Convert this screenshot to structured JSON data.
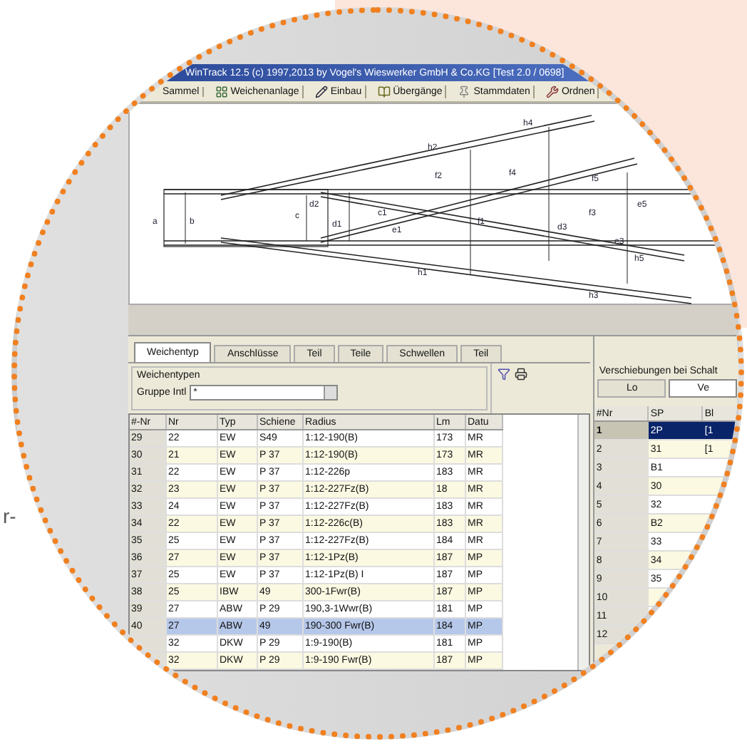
{
  "page_text": "r-",
  "window": {
    "title": "WinTrack 12.5 (c) 1997,2013 by Vogel's Wieswerker GmbH & Co.KG [Test 2.0 / 0698]"
  },
  "toolbar": [
    {
      "label": "Sammel",
      "kind": "none"
    },
    {
      "label": "Weichenanlage",
      "kind": "grid"
    },
    {
      "label": "Einbau",
      "kind": "pencil"
    },
    {
      "label": "Übergänge",
      "kind": "book"
    },
    {
      "label": "Stammdaten",
      "kind": "pin"
    },
    {
      "label": "Ordnen",
      "kind": "tools"
    }
  ],
  "drawing_labels": [
    "a",
    "b",
    "c",
    "d2",
    "d1",
    "c1",
    "e1",
    "h1",
    "h2",
    "f2",
    "f1",
    "h4",
    "f4",
    "f5",
    "f3",
    "h3",
    "d3",
    "e5",
    "e3",
    "h5"
  ],
  "tabs": [
    {
      "label": "Weichentyp",
      "selected": true
    },
    {
      "label": "Anschlüsse",
      "selected": false
    },
    {
      "label": "Teil",
      "selected": false
    },
    {
      "label": "Teile",
      "selected": false
    },
    {
      "label": "Schwellen",
      "selected": false
    },
    {
      "label": "Teil",
      "selected": false
    }
  ],
  "filter": {
    "title": "Weichentypen",
    "label": "Gruppe Intl",
    "value": "*"
  },
  "table": {
    "columns": [
      "#-Nr",
      "Nr",
      "Typ",
      "Schiene",
      "Radius",
      "Lm",
      "Datu"
    ],
    "rows": [
      {
        "cells": [
          "29",
          "22",
          "EW",
          "S49",
          "1:12-190(B)",
          "173",
          "MR"
        ],
        "selected": false
      },
      {
        "cells": [
          "30",
          "21",
          "EW",
          "P 37",
          "1:12-190(B)",
          "173",
          "MR"
        ],
        "selected": false
      },
      {
        "cells": [
          "31",
          "22",
          "EW",
          "P 37",
          "1:12-226p",
          "183",
          "MR"
        ],
        "selected": false
      },
      {
        "cells": [
          "32",
          "23",
          "EW",
          "P 37",
          "1:12-227Fz(B)",
          "18",
          "MR"
        ],
        "selected": false
      },
      {
        "cells": [
          "33",
          "24",
          "EW",
          "P 37",
          "1:12-227Fz(B)",
          "183",
          "MR"
        ],
        "selected": false
      },
      {
        "cells": [
          "34",
          "22",
          "EW",
          "P 37",
          "1:12-226c(B)",
          "183",
          "MR"
        ],
        "selected": false
      },
      {
        "cells": [
          "35",
          "25",
          "EW",
          "P 37",
          "1:12-227Fz(B)",
          "184",
          "MR"
        ],
        "selected": false
      },
      {
        "cells": [
          "36",
          "27",
          "EW",
          "P 37",
          "1:12-1Pz(B)",
          "187",
          "MP"
        ],
        "selected": false
      },
      {
        "cells": [
          "37",
          "25",
          "EW",
          "P 37",
          "1:12-1Pz(B) I",
          "187",
          "MP"
        ],
        "selected": false
      },
      {
        "cells": [
          "38",
          "25",
          "IBW",
          "49",
          "300-1Fwr(B)",
          "187",
          "MP"
        ],
        "selected": false
      },
      {
        "cells": [
          "39",
          "27",
          "ABW",
          "P 29",
          "190,3-1Wwr(B)",
          "181",
          "MP"
        ],
        "selected": false
      },
      {
        "cells": [
          "40",
          "27",
          "ABW",
          "49",
          "190-300 Fwr(B)",
          "184",
          "MP"
        ],
        "selected": true
      },
      {
        "cells": [
          null,
          "32",
          "DKW",
          "P 29",
          "1:9-190(B)",
          "181",
          "MP"
        ],
        "selected": false
      },
      {
        "cells": [
          null,
          "32",
          "DKW",
          "P 29",
          "1:9-190 Fwr(B)",
          "187",
          "MP"
        ],
        "selected": false
      }
    ]
  },
  "right_panel": {
    "title": "Verschiebungen bei Schalt",
    "tabs": [
      {
        "label": "Lo",
        "selected": false
      },
      {
        "label": "Ve",
        "selected": true
      }
    ],
    "columns": [
      "#Nr",
      "SP",
      "Bl"
    ],
    "rows": [
      {
        "nr": "1",
        "sp": "2P",
        "c3": "[1",
        "selected": true
      },
      {
        "nr": "2",
        "sp": "31",
        "c3": "[1",
        "selected": false
      },
      {
        "nr": "3",
        "sp": "B1",
        "selected": false
      },
      {
        "nr": "4",
        "sp": "30",
        "selected": false
      },
      {
        "nr": "5",
        "sp": "32",
        "selected": false
      },
      {
        "nr": "6",
        "sp": "B2",
        "selected": false
      },
      {
        "nr": "7",
        "sp": "33",
        "selected": false
      },
      {
        "nr": "8",
        "sp": "34",
        "selected": false
      },
      {
        "nr": "9",
        "sp": "35",
        "selected": false
      },
      {
        "nr": "10",
        "selected": false
      },
      {
        "nr": "11",
        "selected": false
      },
      {
        "nr": "12",
        "selected": false
      }
    ]
  }
}
